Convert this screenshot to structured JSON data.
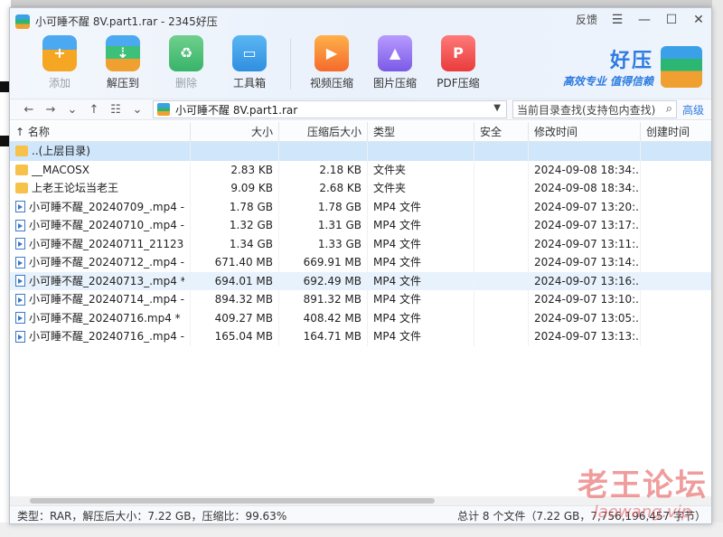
{
  "window": {
    "title": "小可睡不醒 8V.part1.rar - 2345好压",
    "feedback_label": "反馈",
    "menu_icon": "hamburger-icon",
    "minimize_icon": "minimize-icon",
    "maximize_icon": "maximize-icon",
    "close_icon": "close-icon"
  },
  "toolbar": {
    "add": "添加",
    "extract": "解压到",
    "delete": "删除",
    "tools": "工具箱",
    "video": "视频压缩",
    "image": "图片压缩",
    "pdf": "PDF压缩"
  },
  "brand": {
    "name": "好压",
    "slogan": "高效专业 值得信赖"
  },
  "address": {
    "path": "小可睡不醒 8V.part1.rar",
    "search_placeholder": "当前目录查找(支持包内查找)",
    "advanced": "高级"
  },
  "columns": [
    "名称",
    "大小",
    "压缩后大小",
    "类型",
    "安全",
    "修改时间",
    "创建时间"
  ],
  "rows": [
    {
      "name": "..(上层目录)",
      "size": "",
      "packed": "",
      "type": "",
      "safe": "",
      "mtime": "",
      "ctime": "",
      "icon": "folder"
    },
    {
      "name": "__MACOSX",
      "size": "2.83 KB",
      "packed": "2.18 KB",
      "type": "文件夹",
      "safe": "",
      "mtime": "2024-09-08 18:34:...",
      "ctime": "",
      "icon": "folder"
    },
    {
      "name": "上老王论坛当老王",
      "size": "9.09 KB",
      "packed": "2.68 KB",
      "type": "文件夹",
      "safe": "",
      "mtime": "2024-09-08 18:34:...",
      "ctime": "",
      "icon": "folder"
    },
    {
      "name": "小可睡不醒_20240709_.mp4 -...",
      "size": "1.78 GB",
      "packed": "1.78 GB",
      "type": "MP4 文件",
      "safe": "",
      "mtime": "2024-09-07 13:20:...",
      "ctime": "",
      "icon": "video"
    },
    {
      "name": "小可睡不醒_20240710_.mp4 -...",
      "size": "1.32 GB",
      "packed": "1.31 GB",
      "type": "MP4 文件",
      "safe": "",
      "mtime": "2024-09-07 13:17:...",
      "ctime": "",
      "icon": "video"
    },
    {
      "name": "小可睡不醒_20240711_21123...",
      "size": "1.34 GB",
      "packed": "1.33 GB",
      "type": "MP4 文件",
      "safe": "",
      "mtime": "2024-09-07 13:11:...",
      "ctime": "",
      "icon": "video"
    },
    {
      "name": "小可睡不醒_20240712_.mp4 -...",
      "size": "671.40 MB",
      "packed": "669.91 MB",
      "type": "MP4 文件",
      "safe": "",
      "mtime": "2024-09-07 13:14:...",
      "ctime": "",
      "icon": "video"
    },
    {
      "name": "小可睡不醒_20240713_.mp4 *",
      "size": "694.01 MB",
      "packed": "692.49 MB",
      "type": "MP4 文件",
      "safe": "",
      "mtime": "2024-09-07 13:16:...",
      "ctime": "",
      "icon": "video"
    },
    {
      "name": "小可睡不醒_20240714_.mp4 -...",
      "size": "894.32 MB",
      "packed": "891.32 MB",
      "type": "MP4 文件",
      "safe": "",
      "mtime": "2024-09-07 13:10:...",
      "ctime": "",
      "icon": "video"
    },
    {
      "name": "小可睡不醒_20240716.mp4 *",
      "size": "409.27 MB",
      "packed": "408.42 MB",
      "type": "MP4 文件",
      "safe": "",
      "mtime": "2024-09-07 13:05:...",
      "ctime": "",
      "icon": "video"
    },
    {
      "name": "小可睡不醒_20240716_.mp4 -...",
      "size": "165.04 MB",
      "packed": "164.71 MB",
      "type": "MP4 文件",
      "safe": "",
      "mtime": "2024-09-07 13:13:...",
      "ctime": "",
      "icon": "video"
    }
  ],
  "status": {
    "left": "类型：RAR，解压后大小：7.22 GB，压缩比：99.63%",
    "right": "总计 8 个文件（7.22 GB，7,756,196,457 字节）"
  },
  "watermark": {
    "line1": "老王论坛",
    "line2": "laowang.vip"
  },
  "colors": {
    "accent": "#2d7be0",
    "selected_row": "#cfe6fb",
    "watermark": "#e14b4b"
  }
}
